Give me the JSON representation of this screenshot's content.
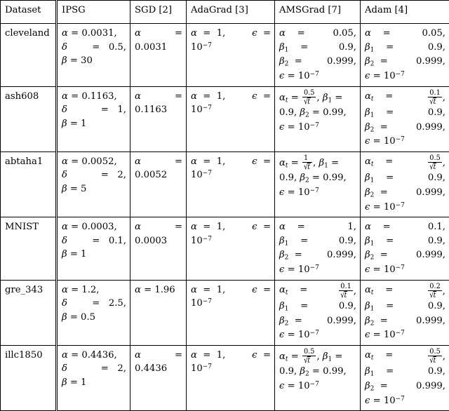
{
  "table": {
    "columns": [
      {
        "key": "dataset",
        "label": "Dataset"
      },
      {
        "key": "ipsg",
        "label": "IPSG"
      },
      {
        "key": "sgd",
        "label": "SGD [2]"
      },
      {
        "key": "adagrad",
        "label": "AdaGrad [3]"
      },
      {
        "key": "amsgrad",
        "label": "AMSGrad [7]"
      },
      {
        "key": "adam",
        "label": "Adam [4]"
      }
    ],
    "rows": [
      {
        "dataset": "cleveland",
        "ipsg": {
          "alpha": "0.0031",
          "delta": "0.5",
          "beta": "30",
          "text": "α = 0.0031, δ = 0.5, β = 30"
        },
        "sgd": {
          "alpha": "0.0031",
          "text": "α = 0.0031"
        },
        "adagrad": {
          "alpha": "1",
          "epsilon": "10^-7",
          "text": "α = 1, ϵ = 10^-7"
        },
        "amsgrad": {
          "alpha": "0.05",
          "alpha_is_decaying": false,
          "beta1": "0.9",
          "beta2": "0.999",
          "epsilon": "10^-7",
          "text": "α = 0.05, β₁ = 0.9, β₂ = 0.999, ϵ = 10^-7"
        },
        "adam": {
          "alpha": "0.05",
          "alpha_is_decaying": false,
          "beta1": "0.9",
          "beta2": "0.999",
          "epsilon": "10^-7",
          "text": "α = 0.05, β₁ = 0.9, β₂ = 0.999, ϵ = 10^-7"
        }
      },
      {
        "dataset": "ash608",
        "ipsg": {
          "alpha": "0.1163",
          "delta": "1",
          "beta": "1",
          "text": "α = 0.1163, δ = 1, β = 1"
        },
        "sgd": {
          "alpha": "0.1163",
          "text": "α = 0.1163"
        },
        "adagrad": {
          "alpha": "1",
          "epsilon": "10^-7",
          "text": "α = 1, ϵ = 10^-7"
        },
        "amsgrad": {
          "alpha_numerator": "0.5",
          "alpha_denominator": "√t",
          "alpha_is_decaying": true,
          "beta1": "0.9",
          "beta2": "0.99",
          "epsilon": "10^-7",
          "text": "αₜ = 0.5/√t, β₁ = 0.9, β₂ = 0.99, ϵ = 10^-7"
        },
        "adam": {
          "alpha_numerator": "0.1",
          "alpha_denominator": "√t",
          "alpha_is_decaying": true,
          "beta1": "0.9",
          "beta2": "0.999",
          "epsilon": "10^-7",
          "text": "αₜ = 0.1/√t, β₁ = 0.9, β₂ = 0.999, ϵ = 10^-7"
        }
      },
      {
        "dataset": "abtaha1",
        "ipsg": {
          "alpha": "0.0052",
          "delta": "2",
          "beta": "5",
          "text": "α = 0.0052, δ = 2, β = 5"
        },
        "sgd": {
          "alpha": "0.0052",
          "text": "α = 0.0052"
        },
        "adagrad": {
          "alpha": "1",
          "epsilon": "10^-7",
          "text": "α = 1, ϵ = 10^-7"
        },
        "amsgrad": {
          "alpha_numerator": "1",
          "alpha_denominator": "√t",
          "alpha_is_decaying": true,
          "beta1": "0.9",
          "beta2": "0.99",
          "epsilon": "10^-7",
          "text": "αₜ = 1/√t, β₁ = 0.9, β₂ = 0.99, ϵ = 10^-7"
        },
        "adam": {
          "alpha_numerator": "0.5",
          "alpha_denominator": "√t",
          "alpha_is_decaying": true,
          "beta1": "0.9",
          "beta2": "0.999",
          "epsilon": "10^-7",
          "text": "αₜ = 0.5/√t, β₁ = 0.9, β₂ = 0.999, ϵ = 10^-7"
        }
      },
      {
        "dataset": "MNIST",
        "ipsg": {
          "alpha": "0.0003",
          "delta": "0.1",
          "beta": "1",
          "text": "α = 0.0003, δ = 0.1, β = 1"
        },
        "sgd": {
          "alpha": "0.0003",
          "text": "α = 0.0003"
        },
        "adagrad": {
          "alpha": "1",
          "epsilon": "10^-7",
          "text": "α = 1, ϵ = 10^-7"
        },
        "amsgrad": {
          "alpha": "1",
          "alpha_is_decaying": false,
          "beta1": "0.9",
          "beta2": "0.999",
          "epsilon": "10^-7",
          "text": "α = 1, β₁ = 0.9, β₂ = 0.999, ϵ = 10^-7"
        },
        "adam": {
          "alpha": "0.1",
          "alpha_is_decaying": false,
          "beta1": "0.9",
          "beta2": "0.999",
          "epsilon": "10^-7",
          "text": "α = 0.1, β₁ = 0.9, β₂ = 0.999, ϵ = 10^-7"
        }
      },
      {
        "dataset": "gre_343",
        "ipsg": {
          "alpha": "1.2",
          "delta": "2.5",
          "beta": "0.5",
          "text": "α = 1.2, δ = 2.5, β = 0.5"
        },
        "sgd": {
          "alpha": "1.96",
          "text": "α = 1.96"
        },
        "adagrad": {
          "alpha": "1",
          "epsilon": "10^-7",
          "text": "α = 1, ϵ = 10^-7"
        },
        "amsgrad": {
          "alpha_numerator": "0.1",
          "alpha_denominator": "√t",
          "alpha_is_decaying": true,
          "beta1": "0.9",
          "beta2": "0.999",
          "epsilon": "10^-7",
          "text": "αₜ = 0.1/√t, β₁ = 0.9, β₂ = 0.999, ϵ = 10^-7"
        },
        "adam": {
          "alpha_numerator": "0.2",
          "alpha_denominator": "√t",
          "alpha_is_decaying": true,
          "beta1": "0.9",
          "beta2": "0.999",
          "epsilon": "10^-7",
          "text": "αₜ = 0.2/√t, β₁ = 0.9, β₂ = 0.999, ϵ = 10^-7"
        }
      },
      {
        "dataset": "illc1850",
        "ipsg": {
          "alpha": "0.4436",
          "delta": "2",
          "beta": "1",
          "text": "α = 0.4436, δ = 2, β = 1"
        },
        "sgd": {
          "alpha": "0.4436",
          "text": "α = 0.4436"
        },
        "adagrad": {
          "alpha": "1",
          "epsilon": "10^-7",
          "text": "α = 1, ϵ = 10^-7"
        },
        "amsgrad": {
          "alpha_numerator": "0.5",
          "alpha_denominator": "√t",
          "alpha_is_decaying": true,
          "beta1": "0.9",
          "beta2": "0.99",
          "epsilon": "10^-7",
          "text": "αₜ = 0.5/√t, β₁ = 0.9, β₂ = 0.99, ϵ = 10^-7"
        },
        "adam": {
          "alpha_numerator": "0.5",
          "alpha_denominator": "√t",
          "alpha_is_decaying": true,
          "beta1": "0.9",
          "beta2": "0.999",
          "epsilon": "10^-7",
          "text": "αₜ = 0.5/√t, β₁ = 0.9, β₂ = 0.999, ϵ = 10^-7"
        }
      }
    ]
  },
  "symbols": {
    "alpha": "α",
    "alpha_t": "α",
    "beta": "β",
    "delta": "δ",
    "epsilon": "ϵ",
    "equals": "=",
    "comma": ",",
    "t": "t",
    "ten": "10",
    "exp_neg7": "−7",
    "sub1": "1",
    "sub2": "2"
  },
  "colors": {
    "text": "#000000",
    "background": "#ffffff",
    "rule": "#000000"
  }
}
